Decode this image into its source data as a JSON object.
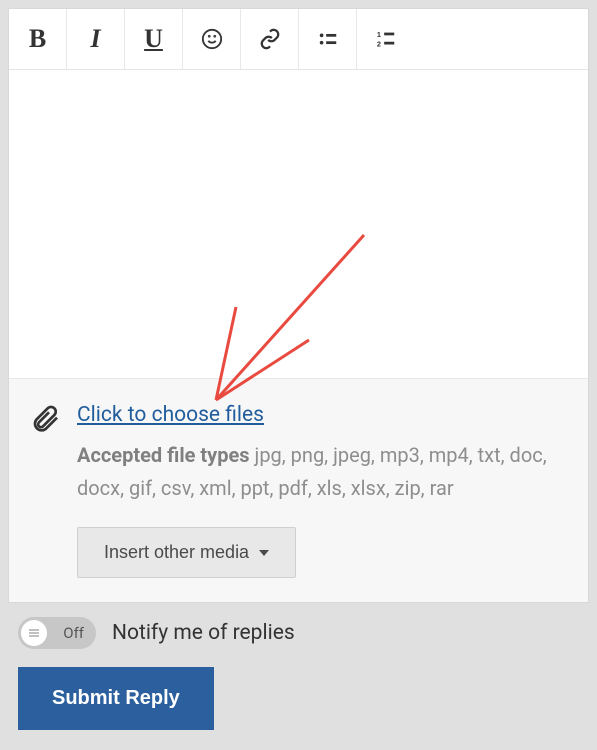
{
  "toolbar": {
    "bold": "B",
    "italic": "I",
    "underline": "U"
  },
  "attachment": {
    "choose_link": "Click to choose files",
    "accepted_label": "Accepted file types",
    "accepted_list": "jpg, png, jpeg, mp3, mp4, txt, doc, docx, gif, csv, xml, ppt, pdf, xls, xlsx, zip, rar",
    "insert_media": "Insert other media"
  },
  "footer": {
    "toggle_state": "Off",
    "notify_label": "Notify me of replies",
    "submit_label": "Submit Reply"
  }
}
